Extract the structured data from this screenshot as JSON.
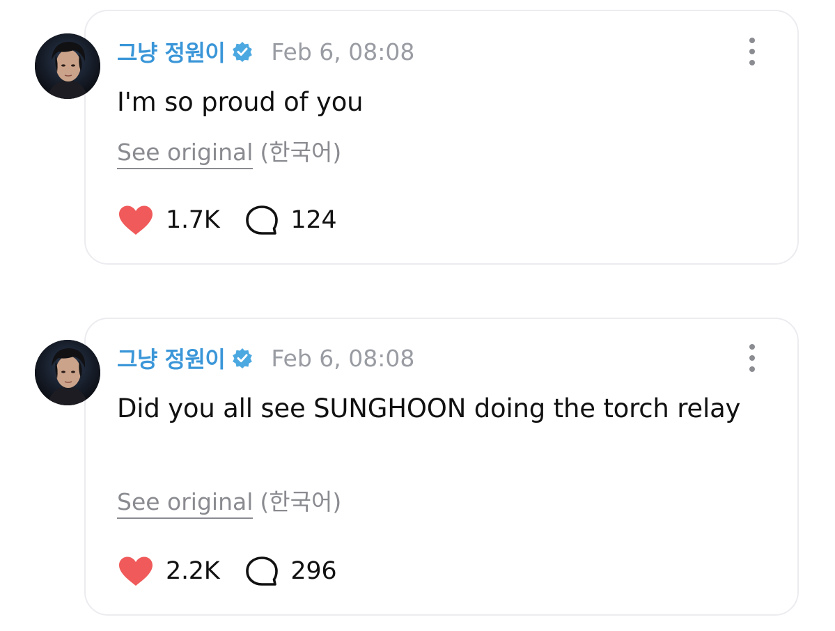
{
  "colors": {
    "username": "#3a96d8",
    "verified_badge": "#4ca8e0",
    "timestamp": "#9a9ca3",
    "like_heart": "#f05a5a",
    "card_border": "#ececf0"
  },
  "posts": [
    {
      "username": "그냥 정원이",
      "verified_icon": "verified-check-badge",
      "timestamp": "Feb 6, 08:08",
      "text": "I'm so proud of you",
      "see_original_label": "See original",
      "language": "(한국어)",
      "likes": "1.7K",
      "comments": "124"
    },
    {
      "username": "그냥 정원이",
      "verified_icon": "verified-check-badge",
      "timestamp": "Feb 6, 08:08",
      "text": "Did you all see SUNGHOON doing the torch relay",
      "see_original_label": "See original",
      "language": "(한국어)",
      "likes": "2.2K",
      "comments": "296"
    }
  ]
}
